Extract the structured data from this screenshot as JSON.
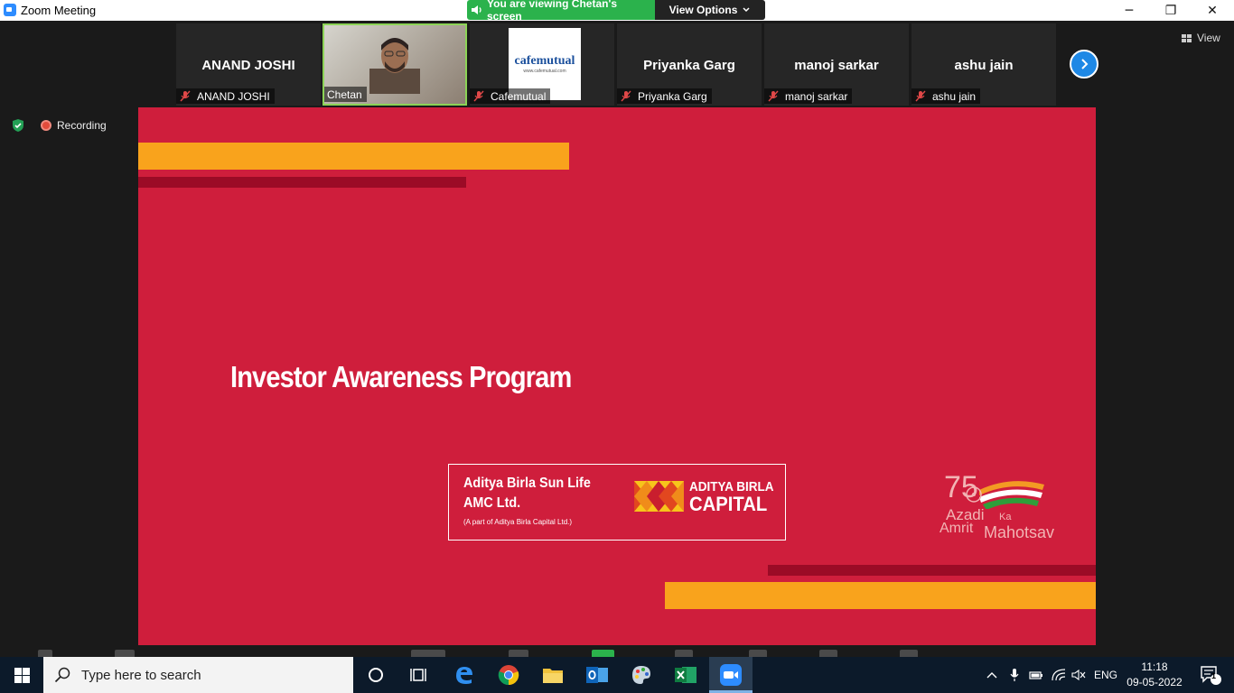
{
  "window": {
    "title": "Zoom Meeting",
    "minimize_glyph": "─",
    "restore_glyph": "❐",
    "close_glyph": "✕"
  },
  "share_banner": {
    "text": "You are viewing Chetan's screen",
    "options_label": "View Options",
    "banner_color": "#2bb24c"
  },
  "gallery": {
    "participants": [
      {
        "display": "ANAND JOSHI",
        "nameplate": "ANAND JOSHI",
        "muted": true,
        "video": false
      },
      {
        "display": "",
        "nameplate": "Chetan",
        "muted": false,
        "video": true
      },
      {
        "display": "",
        "nameplate": "Cafemutual",
        "muted": true,
        "video": false,
        "logo_text": "cafemutual",
        "logo_sub": "www.cafemutual.com"
      },
      {
        "display": "Priyanka Garg",
        "nameplate": "Priyanka Garg",
        "muted": true,
        "video": false
      },
      {
        "display": "manoj sarkar",
        "nameplate": "manoj sarkar",
        "muted": true,
        "video": false
      },
      {
        "display": "ashu jain",
        "nameplate": "ashu jain",
        "muted": true,
        "video": false
      }
    ],
    "view_label": "View"
  },
  "recording": {
    "label": "Recording"
  },
  "slide": {
    "title": "Investor Awareness Program",
    "company_line1": "Aditya Birla Sun Life",
    "company_line2": "AMC Ltd.",
    "company_note": "(A part of Aditya Birla Capital Ltd.)",
    "brand_line1": "ADITYA BIRLA",
    "brand_line2": "CAPITAL",
    "azadi_75": "75",
    "azadi_1": "Azadi",
    "azadi_ka": "Ka",
    "azadi_2": "Amrit",
    "azadi_3": "Mahotsav",
    "background_color": "#cf1e3c",
    "accent_orange": "#f9a31c",
    "accent_dark": "#9b0b26"
  },
  "taskbar": {
    "search_placeholder": "Type here to search",
    "language": "ENG",
    "time": "11:18",
    "date": "09-05-2022",
    "notification_count": "1",
    "pinned": [
      "cortana-icon",
      "task-view-icon",
      "edge-icon",
      "chrome-icon",
      "file-explorer-icon",
      "outlook-icon",
      "paint-icon",
      "excel-icon",
      "zoom-icon"
    ]
  }
}
